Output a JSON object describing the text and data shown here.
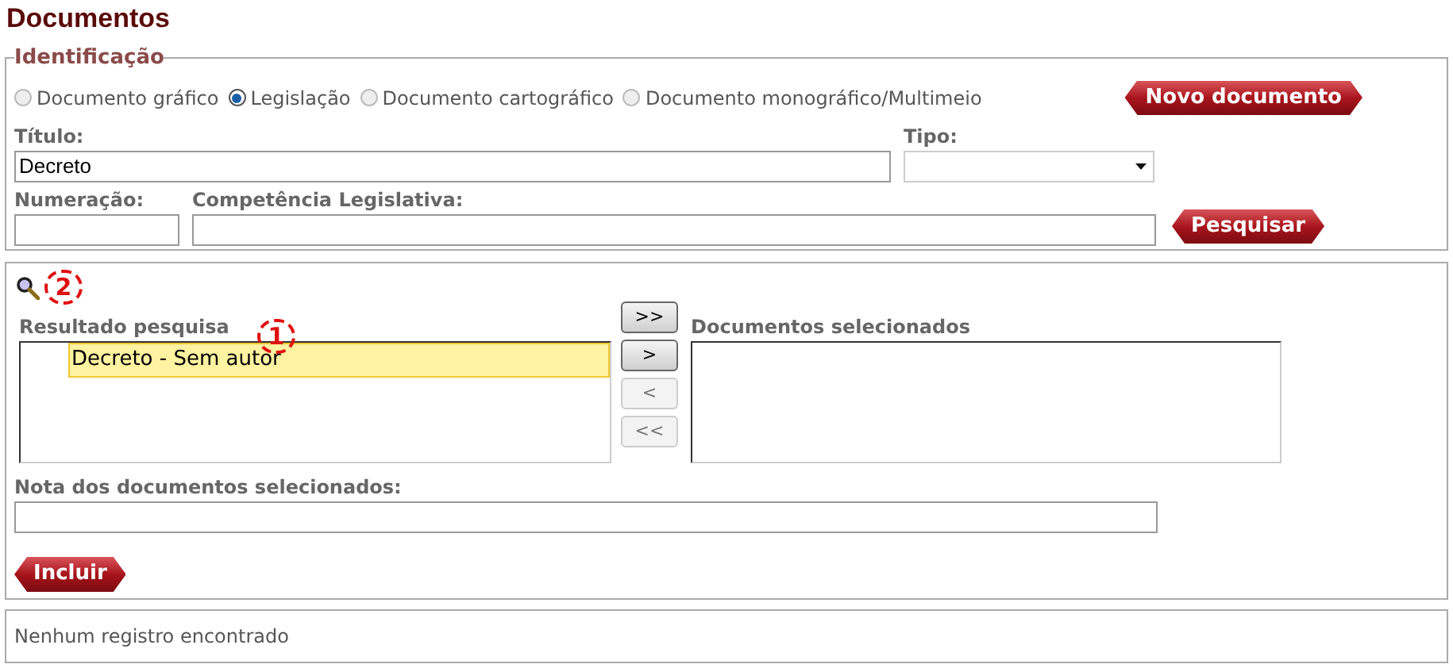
{
  "page_title": "Documentos",
  "identificacao": {
    "legend": "Identificação",
    "radios": [
      {
        "label": "Documento gráfico",
        "selected": false
      },
      {
        "label": "Legislação",
        "selected": true
      },
      {
        "label": "Documento cartográfico",
        "selected": false
      },
      {
        "label": "Documento monográfico/Multimeio",
        "selected": false
      }
    ],
    "new_button": "Novo documento",
    "titulo": {
      "label": "Título:",
      "value": "Decreto"
    },
    "tipo": {
      "label": "Tipo:"
    },
    "numeracao": {
      "label": "Numeração:"
    },
    "competencia": {
      "label": "Competência Legislativa:"
    },
    "search_button": "Pesquisar"
  },
  "selection": {
    "annotations": [
      "2",
      "1"
    ],
    "results": {
      "label": "Resultado pesquisa",
      "items": [
        {
          "text": "Decreto - Sem autor",
          "selected": true
        }
      ]
    },
    "move_buttons": [
      {
        "label": ">>",
        "disabled": false
      },
      {
        "label": ">",
        "disabled": false
      },
      {
        "label": "<",
        "disabled": true
      },
      {
        "label": "<<",
        "disabled": true
      }
    ],
    "selected_docs": {
      "label": "Documentos selecionados"
    },
    "nota": {
      "label": "Nota dos documentos selecionados:"
    },
    "include_button": "Incluir"
  },
  "status": "Nenhum registro encontrado"
}
